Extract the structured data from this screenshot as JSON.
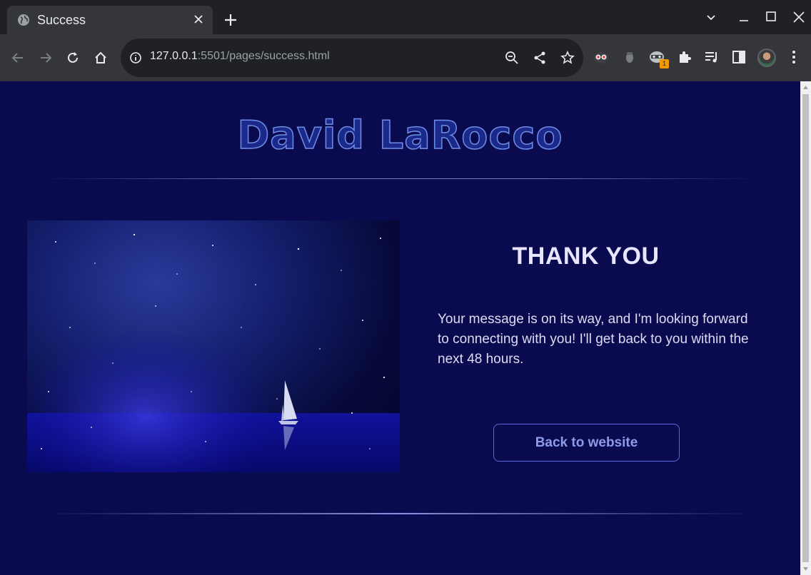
{
  "browser": {
    "tab_title": "Success",
    "url_host": "127.0.0.1",
    "url_rest": ":5501/pages/success.html",
    "extension_badge": "1"
  },
  "page": {
    "site_title": "David LaRocco",
    "heading": "THANK YOU",
    "message": "Your message is on its way, and I'm looking forward to connecting with you! I'll get back to you within the next 48 hours.",
    "button_label": "Back to website"
  },
  "colors": {
    "page_background": "#0a0a4f",
    "title_stroke": "#6f8ee8",
    "button_border": "#5868d8"
  }
}
